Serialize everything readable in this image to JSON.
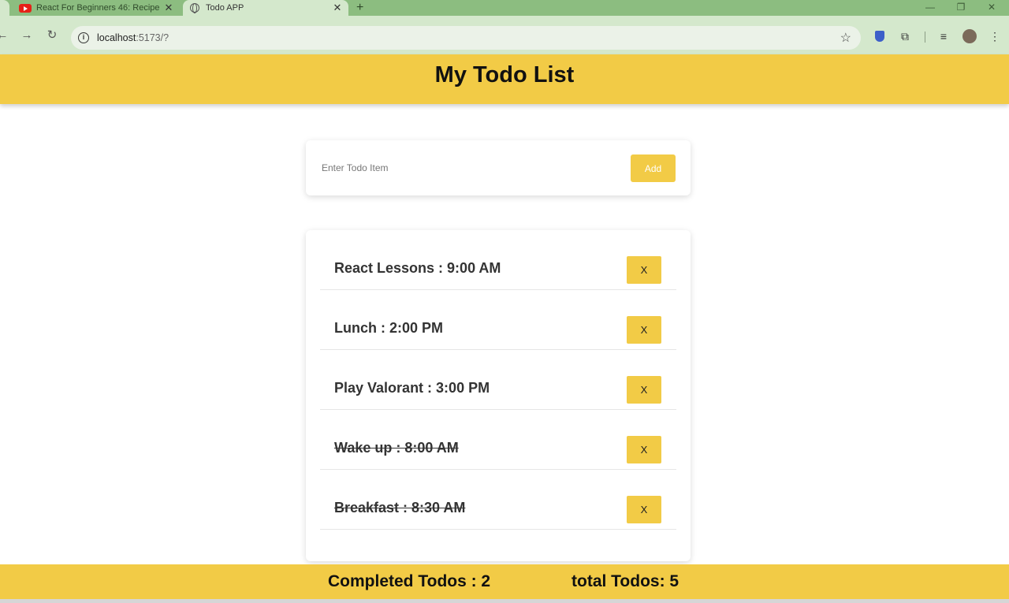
{
  "browser": {
    "tabs": [
      {
        "title": "React For Beginners 46: Recipe",
        "icon": "youtube-icon"
      },
      {
        "title": "Todo APP",
        "icon": "globe-icon"
      }
    ],
    "new_tab_glyph": "+",
    "url_host": "localhost",
    "url_rest": ":5173/?"
  },
  "app": {
    "title": "My Todo List",
    "input_placeholder": "Enter Todo Item",
    "add_label": "Add",
    "delete_label": "X",
    "todos": [
      {
        "text": "React Lessons : 9:00 AM",
        "completed": false
      },
      {
        "text": "Lunch : 2:00 PM",
        "completed": false
      },
      {
        "text": "Play Valorant : 3:00 PM",
        "completed": false
      },
      {
        "text": "Wake up : 8:00 AM",
        "completed": true
      },
      {
        "text": "Breakfast : 8:30 AM",
        "completed": true
      }
    ],
    "footer": {
      "completed": "Completed Todos : 2",
      "total": "total Todos: 5"
    },
    "accent_color": "#f2cb46"
  }
}
